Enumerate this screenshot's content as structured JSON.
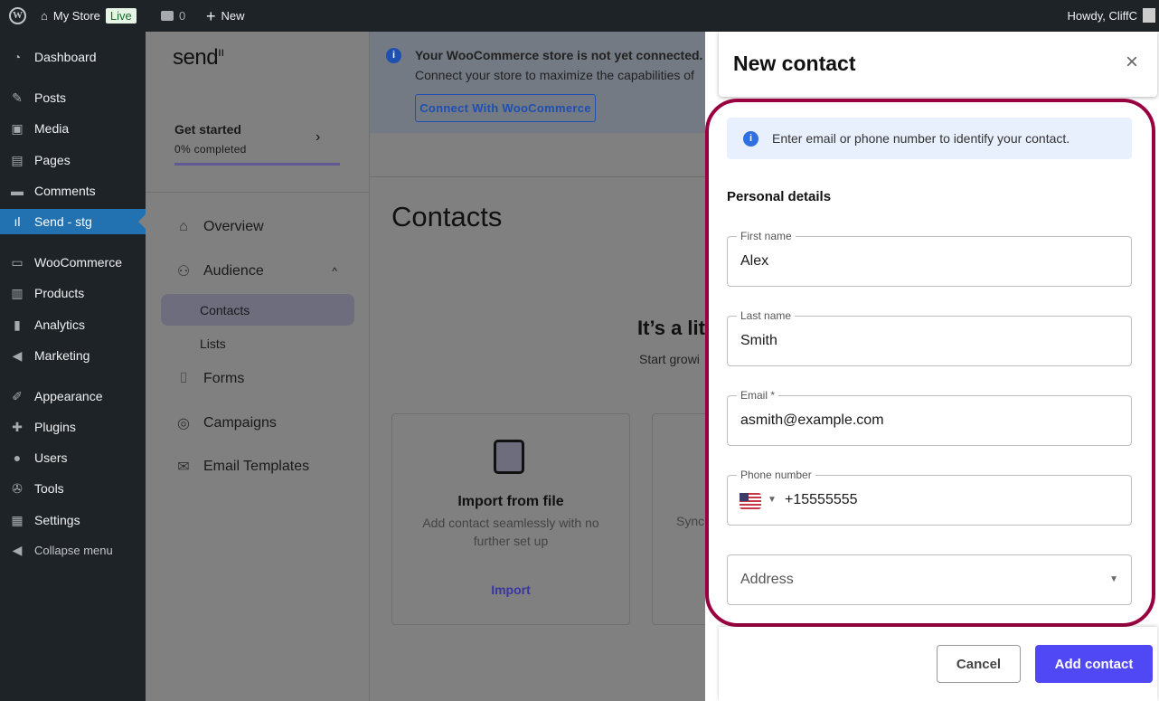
{
  "topbar": {
    "site": "My Store",
    "badge": "Live",
    "comments": "0",
    "new": "New",
    "howdy": "Howdy, CliffC"
  },
  "wp_menu": [
    {
      "label": "Dashboard",
      "icon": "dashboard-icon"
    },
    {
      "label": "Posts",
      "icon": "pin-icon"
    },
    {
      "label": "Media",
      "icon": "media-icon"
    },
    {
      "label": "Pages",
      "icon": "pages-icon"
    },
    {
      "label": "Comments",
      "icon": "comment-icon"
    },
    {
      "label": "Send - stg",
      "icon": "send-icon",
      "active": true
    },
    {
      "label": "WooCommerce",
      "icon": "woo-icon"
    },
    {
      "label": "Products",
      "icon": "products-icon"
    },
    {
      "label": "Analytics",
      "icon": "analytics-icon"
    },
    {
      "label": "Marketing",
      "icon": "megaphone-icon"
    },
    {
      "label": "Appearance",
      "icon": "brush-icon"
    },
    {
      "label": "Plugins",
      "icon": "plugin-icon"
    },
    {
      "label": "Users",
      "icon": "user-icon"
    },
    {
      "label": "Tools",
      "icon": "wrench-icon"
    },
    {
      "label": "Settings",
      "icon": "settings-icon"
    },
    {
      "label": "Collapse menu",
      "icon": "collapse-icon"
    }
  ],
  "plugin": {
    "logo": "send",
    "get_started": "Get started",
    "progress_text": "0% completed",
    "progress": 0,
    "nav": {
      "overview": "Overview",
      "audience": "Audience",
      "contacts": "Contacts",
      "lists": "Lists",
      "forms": "Forms",
      "campaigns": "Campaigns",
      "email_templates": "Email Templates"
    }
  },
  "banner": {
    "title": "Your WooCommerce store is not yet connected.",
    "text": "Connect your store to maximize the capabilities of",
    "button": "Connect With WooCommerce"
  },
  "main": {
    "title": "Contacts",
    "empty_title": "It’s a lit",
    "empty_text": "Start growi",
    "card1": {
      "title": "Import from file",
      "desc": "Add contact seamlessly with no further set up",
      "link": "Import"
    },
    "card2": {
      "desc": "Sync"
    }
  },
  "modal": {
    "title": "New contact",
    "info": "Enter email or phone number to identify your contact.",
    "section": "Personal details",
    "first_name": {
      "label": "First name",
      "value": "Alex"
    },
    "last_name": {
      "label": "Last name",
      "value": "Smith"
    },
    "email": {
      "label": "Email *",
      "value": "asmith@example.com"
    },
    "phone": {
      "label": "Phone number",
      "value": "+15555555",
      "country": "US"
    },
    "address": {
      "placeholder": "Address"
    },
    "cancel": "Cancel",
    "submit": "Add contact"
  },
  "colors": {
    "accent": "#5048f5",
    "highlight": "#990040",
    "wp_active": "#2271b1"
  }
}
